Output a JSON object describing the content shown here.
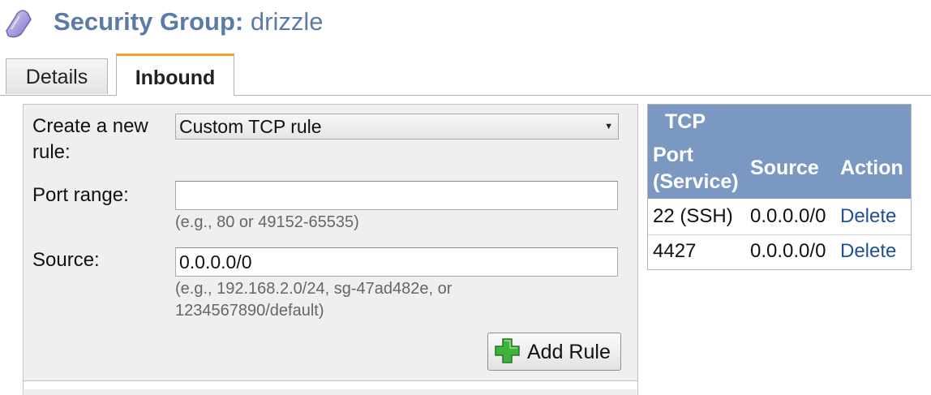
{
  "header": {
    "title_prefix": "Security Group:",
    "group_name": "drizzle",
    "icon": "shield-icon",
    "icon_color": "#9c8fd6"
  },
  "tabs": [
    {
      "label": "Details",
      "active": false
    },
    {
      "label": "Inbound",
      "active": true
    }
  ],
  "form": {
    "rule_label": "Create a new rule:",
    "rule_select_value": "Custom TCP rule",
    "port_label": "Port range:",
    "port_value": "",
    "port_hint": "(e.g., 80 or 49152-65535)",
    "source_label": "Source:",
    "source_value": "0.0.0.0/0",
    "source_hint": "(e.g., 192.168.2.0/24, sg-47ad482e, or 1234567890/default)",
    "add_button_label": "Add Rule",
    "add_button_icon": "plus-icon"
  },
  "rules_table": {
    "group_title": "TCP",
    "columns": [
      "Port (Service)",
      "Source",
      "Action"
    ],
    "rows": [
      {
        "port": "22 (SSH)",
        "source": "0.0.0.0/0",
        "action": "Delete"
      },
      {
        "port": "4427",
        "source": "0.0.0.0/0",
        "action": "Delete"
      }
    ]
  },
  "colors": {
    "title": "#5a7aa8",
    "active_tab_accent": "#f3a21a",
    "table_header": "#7b98c2",
    "link": "#1f4f9a",
    "plus_green": "#3fb23f"
  }
}
